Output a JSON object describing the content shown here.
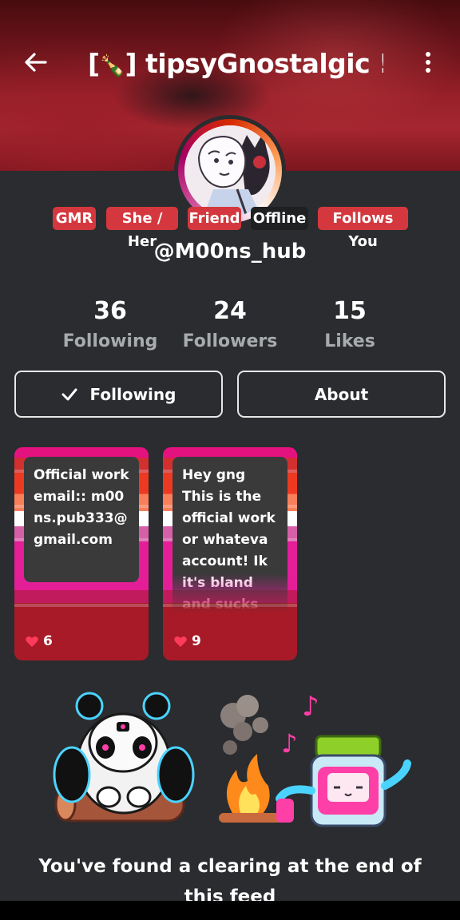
{
  "header": {
    "title_prefix": "[",
    "title_emoji": "🍾",
    "title_main": "] tipsyGnostalgic !",
    "title_star": "★"
  },
  "badges": [
    {
      "label": "GMR",
      "color": "#d4383e"
    },
    {
      "label": "She / Her",
      "color": "#d4383e"
    },
    {
      "label": "Friend",
      "color": "#d4383e"
    },
    {
      "label": "Offline",
      "color": "#1e2022"
    },
    {
      "label": "Follows You",
      "color": "#d4383e"
    }
  ],
  "profile": {
    "handle": "@M00ns_hub"
  },
  "stats": [
    {
      "value": "36",
      "label": "Following"
    },
    {
      "value": "24",
      "label": "Followers"
    },
    {
      "value": "15",
      "label": "Likes"
    }
  ],
  "actions": {
    "following_label": "Following",
    "about_label": "About"
  },
  "posts": [
    {
      "text": "Official work email:: m00ns.pub333@gmail.com",
      "likes": "6"
    },
    {
      "text": "Hey gng This is the official work or whateva account! Ik it's bland and sucks rn",
      "likes": "9"
    }
  ],
  "feed_end": {
    "message": "You've found a clearing at the end of this feed"
  },
  "colors": {
    "background": "#2a2c2f",
    "badge": "#d4383e",
    "heart": "#ff3b5c"
  }
}
